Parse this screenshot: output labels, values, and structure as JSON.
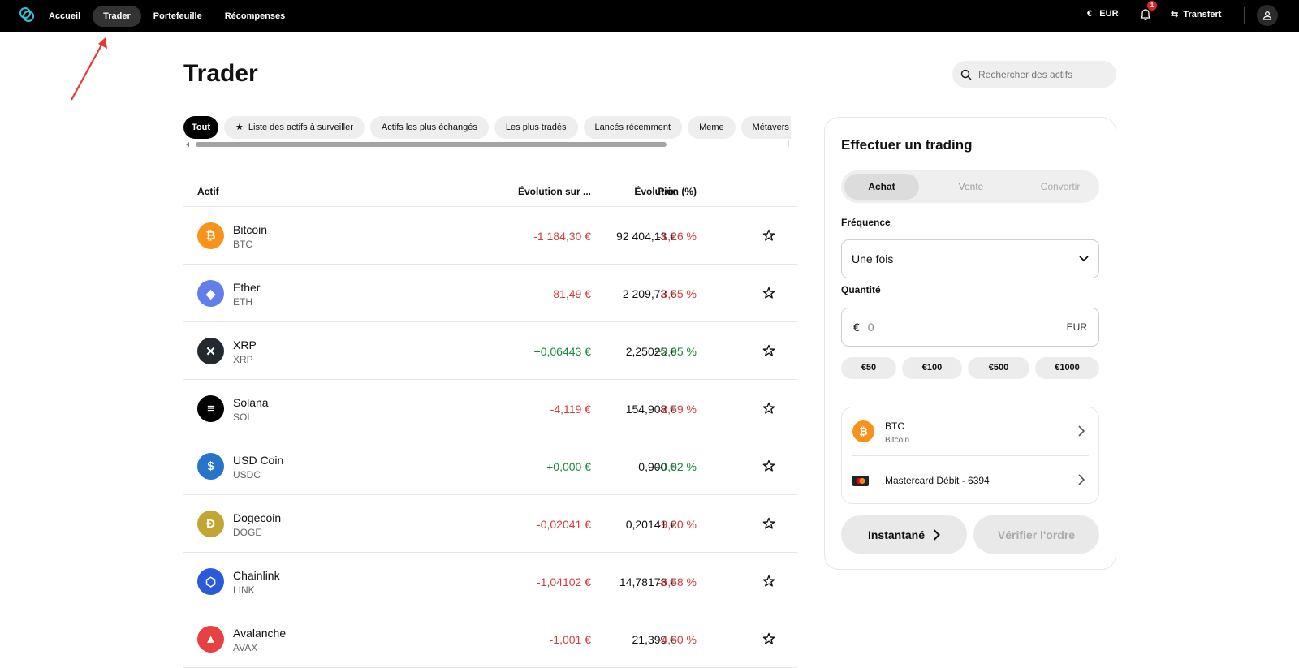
{
  "nav": {
    "items": [
      {
        "label": "Accueil"
      },
      {
        "label": "Trader"
      },
      {
        "label": "Portefeuille"
      },
      {
        "label": "Récompenses"
      }
    ],
    "active_index": 1,
    "currency_label": "EUR",
    "notification_count": "1",
    "transfer_label": "Transfert"
  },
  "page": {
    "title": "Trader",
    "search_placeholder": "Rechercher des actifs"
  },
  "chips": [
    {
      "label": "Tout",
      "active": true
    },
    {
      "label": "Liste des actifs à surveiller",
      "icon": "star-filled-icon"
    },
    {
      "label": "Actifs les plus échangés"
    },
    {
      "label": "Les plus tradés"
    },
    {
      "label": "Lancés récemment"
    },
    {
      "label": "Meme"
    },
    {
      "label": "Métavers"
    }
  ],
  "table": {
    "headers": {
      "asset": "Actif",
      "price": "Prix",
      "change": "Évolution sur ...",
      "pct": "Évolution (%)"
    },
    "rows": [
      {
        "name": "Bitcoin",
        "symbol": "BTC",
        "price": "92 404,13 €",
        "change": "-1 184,30 €",
        "pct": "-1,26 %",
        "trend": "neg",
        "icon": "bitcoin-icon",
        "color": "#f7931a",
        "glyph": "₿"
      },
      {
        "name": "Ether",
        "symbol": "ETH",
        "price": "2 209,73 €",
        "change": "-81,49 €",
        "pct": "-3,55 %",
        "trend": "neg",
        "icon": "ether-icon",
        "color": "#627eea",
        "glyph": "◆"
      },
      {
        "name": "XRP",
        "symbol": "XRP",
        "price": "2,25025 €",
        "change": "+0,06443 €",
        "pct": "+2,95 %",
        "trend": "pos",
        "icon": "xrp-icon",
        "color": "#23292f",
        "glyph": "✕"
      },
      {
        "name": "Solana",
        "symbol": "SOL",
        "price": "154,908 €",
        "change": "-4,119 €",
        "pct": "-2,59 %",
        "trend": "neg",
        "icon": "solana-icon",
        "color": "#000000",
        "glyph": "≡"
      },
      {
        "name": "USD Coin",
        "symbol": "USDC",
        "price": "0,900 €",
        "change": "+0,000 €",
        "pct": "+0,02 %",
        "trend": "pos",
        "icon": "usd-coin-icon",
        "color": "#2775ca",
        "glyph": "$"
      },
      {
        "name": "Dogecoin",
        "symbol": "DOGE",
        "price": "0,20141 €",
        "change": "-0,02041 €",
        "pct": "-9,20 %",
        "trend": "neg",
        "icon": "dogecoin-icon",
        "color": "#c2a633",
        "glyph": "Ð"
      },
      {
        "name": "Chainlink",
        "symbol": "LINK",
        "price": "14,78178 €",
        "change": "-1,04102 €",
        "pct": "-6,58 %",
        "trend": "neg",
        "icon": "chainlink-icon",
        "color": "#2a5ada",
        "glyph": "⬡"
      },
      {
        "name": "Avalanche",
        "symbol": "AVAX",
        "price": "21,399 €",
        "change": "-1,001 €",
        "pct": "-4,50 %",
        "trend": "neg",
        "icon": "avalanche-icon",
        "color": "#e84142",
        "glyph": "▲"
      }
    ]
  },
  "trade": {
    "title": "Effectuer un trading",
    "tabs": [
      "Achat",
      "Vente",
      "Convertir"
    ],
    "frequency_label": "Fréquence",
    "frequency_value": "Une fois",
    "quantity_label": "Quantité",
    "currency_symbol": "€",
    "amount_placeholder": "0",
    "currency_code": "EUR",
    "presets": [
      "€50",
      "€100",
      "€500",
      "€1000"
    ],
    "asset_symbol": "BTC",
    "asset_name": "Bitcoin",
    "payment_method": "Mastercard Débit - 6394",
    "instant_label": "Instantané",
    "verify_label": "Vérifier l'ordre"
  }
}
